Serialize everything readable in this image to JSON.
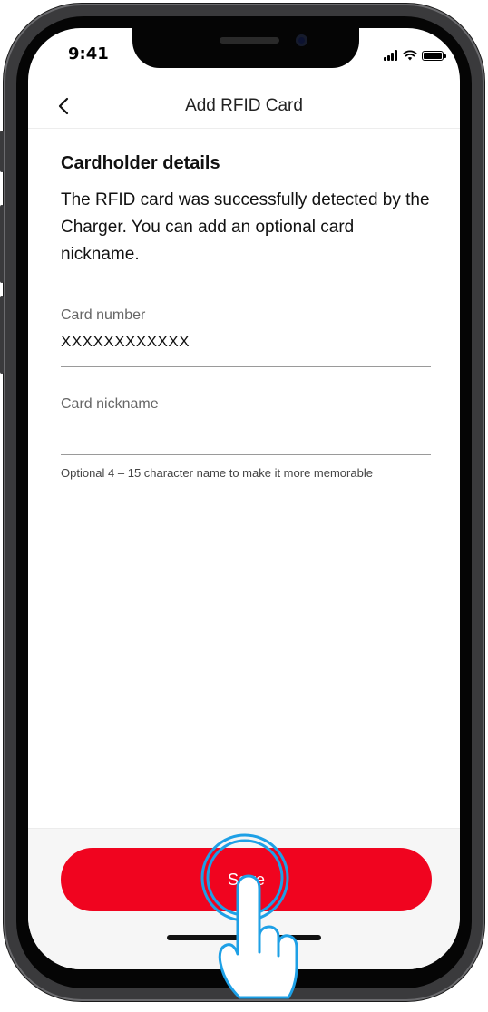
{
  "status_bar": {
    "time": "9:41"
  },
  "nav": {
    "title": "Add RFID Card"
  },
  "section": {
    "title": "Cardholder details",
    "description": "The RFID card was successfully detected by the Charger. You can add an optional card nickname."
  },
  "card_number": {
    "label": "Card number",
    "value": "XXXXXXXXXXXX"
  },
  "card_nickname": {
    "label": "Card nickname",
    "value": "",
    "helper": "Optional 4 – 15 character name to make it more memorable"
  },
  "save": {
    "label": "Save"
  },
  "colors": {
    "accent": "#f0041f",
    "tap_highlight": "#1ea0e6"
  },
  "icons": [
    "chevron-left-icon",
    "signal-icon",
    "wifi-icon",
    "battery-icon",
    "hand-pointer-icon"
  ]
}
